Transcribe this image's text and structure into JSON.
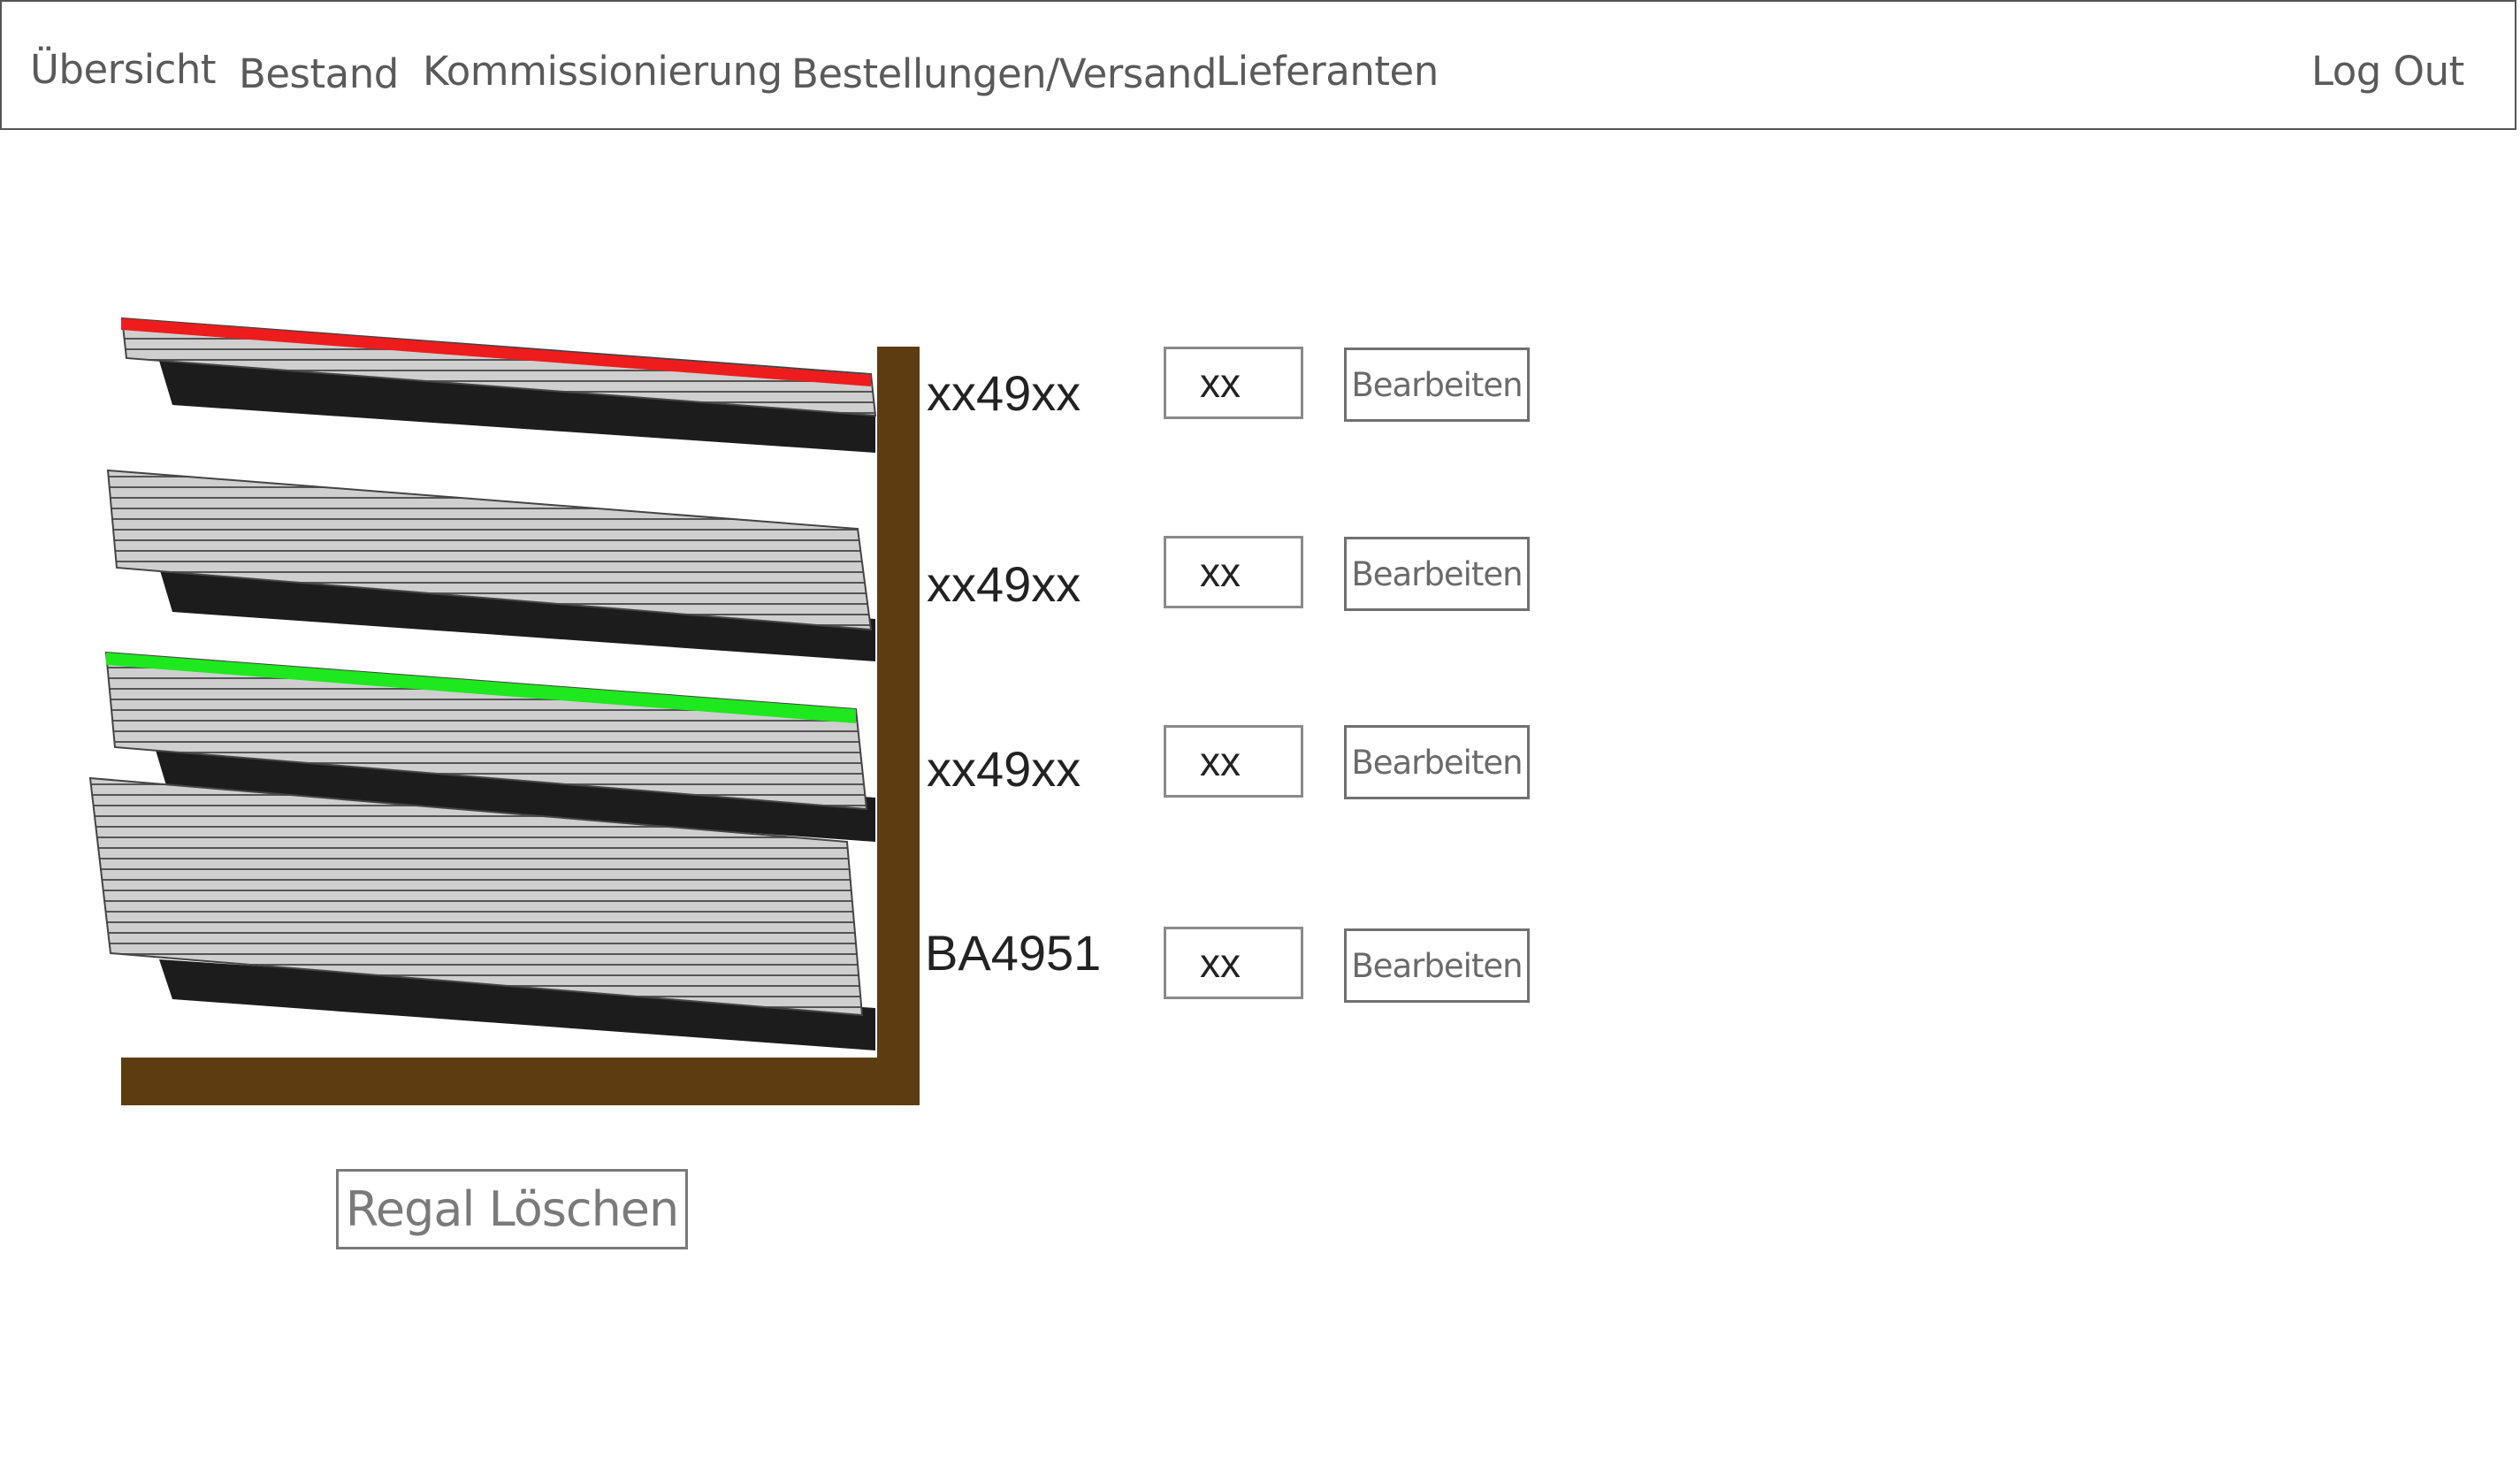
{
  "nav": {
    "items": [
      {
        "label": "Übersicht"
      },
      {
        "label": "Bestand"
      },
      {
        "label": "Kommissionierung"
      },
      {
        "label": "Bestellungen/Versand"
      },
      {
        "label": "Lieferanten"
      }
    ],
    "logout_label": "Log Out"
  },
  "shelf": {
    "slots": [
      {
        "label": "xx49xx",
        "quantity": "xx",
        "edit_label": "Bearbeiten",
        "indicator": "red"
      },
      {
        "label": "xx49xx",
        "quantity": "xx",
        "edit_label": "Bearbeiten",
        "indicator": "none"
      },
      {
        "label": "xx49xx",
        "quantity": "xx",
        "edit_label": "Bearbeiten",
        "indicator": "green"
      },
      {
        "label": "BA4951",
        "quantity": "xx",
        "edit_label": "Bearbeiten",
        "indicator": "none"
      }
    ],
    "delete_label": "Regal Löschen"
  },
  "colors": {
    "wood": "#5e3c12",
    "tray": "#1c1c1c",
    "stack": "#c8c8c8",
    "indicator_red": "#ee1c1c",
    "indicator_green": "#1ee81e"
  }
}
